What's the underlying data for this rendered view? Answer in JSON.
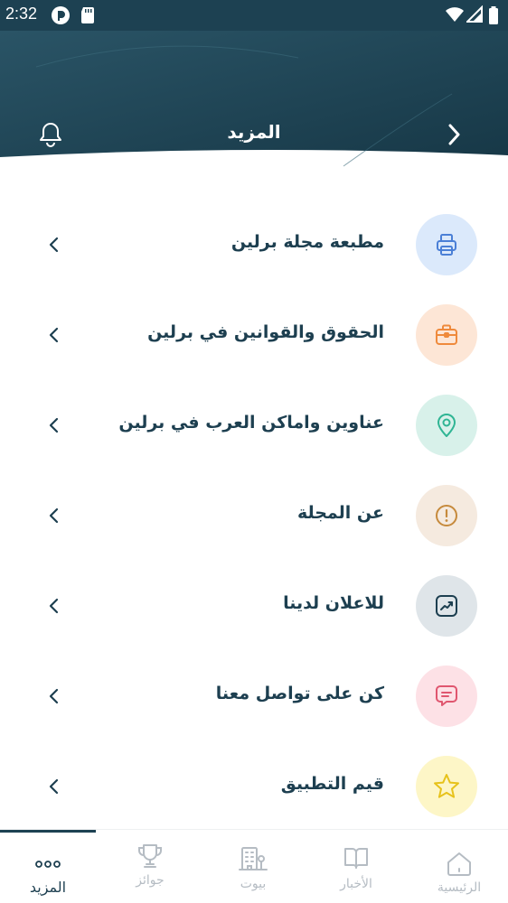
{
  "status_bar": {
    "time": "2:32"
  },
  "header": {
    "title": "المزيد"
  },
  "menu": {
    "items": [
      {
        "label": "مطبعة مجلة برلين",
        "icon": "printer-icon",
        "bg": "#dbe9fb",
        "fg": "#4a7fd6"
      },
      {
        "label": "الحقوق والقوانين في برلين",
        "icon": "briefcase-icon",
        "bg": "#fde6d6",
        "fg": "#ef8a3c"
      },
      {
        "label": "عناوين واماكن العرب في برلين",
        "icon": "location-pin-icon",
        "bg": "#d8f1ea",
        "fg": "#2fb594"
      },
      {
        "label": "عن المجلة",
        "icon": "info-icon",
        "bg": "#f5eadf",
        "fg": "#c68a3c"
      },
      {
        "label": "للاعلان لدينا",
        "icon": "trending-chart-icon",
        "bg": "#dfe5e9",
        "fg": "#1d3f50"
      },
      {
        "label": "كن على تواصل معنا",
        "icon": "chat-message-icon",
        "bg": "#fde1e6",
        "fg": "#e0566f"
      },
      {
        "label": "قيم التطبيق",
        "icon": "star-icon",
        "bg": "#fdf6c7",
        "fg": "#e7c21a"
      }
    ]
  },
  "bottom_nav": {
    "items": [
      {
        "label": "الرئيسية",
        "icon": "home-icon"
      },
      {
        "label": "الأخبار",
        "icon": "book-icon"
      },
      {
        "label": "بيوت",
        "icon": "building-icon"
      },
      {
        "label": "جوائز",
        "icon": "trophy-icon"
      },
      {
        "label": "المزيد",
        "icon": "more-dots-icon",
        "active": true
      }
    ]
  },
  "colors": {
    "primary": "#1d4152",
    "text": "#1d3f50",
    "inactive": "#b5bcc3"
  }
}
